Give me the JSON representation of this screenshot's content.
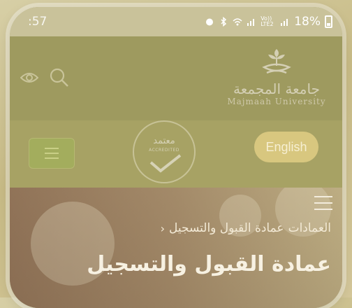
{
  "status_bar": {
    "time": ":57",
    "network_label": "Vo)) LTE2",
    "battery": "18%"
  },
  "header": {
    "logo_arabic": "جامعة المجمعة",
    "logo_english": "Majmaah University",
    "icons": [
      "eye-icon",
      "search-icon"
    ]
  },
  "toolbar": {
    "accreditation_badge_ar": "معتمد",
    "accreditation_badge_en": "ACCREDITED",
    "language_button": "English"
  },
  "hero": {
    "breadcrumb": {
      "parent": "العمادات",
      "current": "عمادة القبول والتسجيل",
      "separator": "‹"
    },
    "title": "عمادة القبول والتسجيل"
  },
  "colors": {
    "header_bg": "#9e9a5f",
    "language_button_bg": "#d8c77f",
    "menu_button_bg": "#a3ad5d"
  }
}
